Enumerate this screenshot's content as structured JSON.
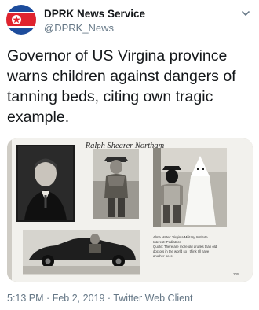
{
  "account": {
    "name": "DPRK News Service",
    "handle": "@DPRK_News"
  },
  "tweet": {
    "text": "Governor of US Virgina province warns children against dangers of tanning beds, citing own tragic example."
  },
  "media": {
    "page_header": "Ralph Shearer Northam",
    "caption_lines": [
      "Alma Mater: Virginia Military Institute",
      "Interest: Pediatrics",
      "Quote: There are more old drunks than old",
      "doctors in the world so I think I'll have",
      "another beer."
    ],
    "page_number": "205"
  },
  "meta": {
    "time": "5:13 PM",
    "separator": "·",
    "date": "Feb 2, 2019",
    "client": "Twitter Web Client"
  },
  "colors": {
    "flag_red": "#e0232e",
    "flag_blue": "#1d4c9c",
    "muted_text": "#657786"
  },
  "icons": {
    "avatar": "north-korea-flag",
    "more": "chevron-down-icon"
  }
}
